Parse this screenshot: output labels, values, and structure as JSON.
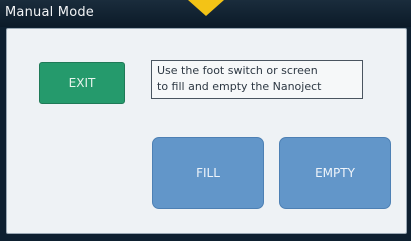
{
  "window": {
    "title": "Manual Mode"
  },
  "indicator": {
    "icon": "down-arrow-indicator-icon",
    "color": "#f3c316"
  },
  "controls": {
    "exit_label": "EXIT",
    "fill_label": "FILL",
    "empty_label": "EMPTY"
  },
  "instructions": {
    "line1": "Use the foot switch or screen",
    "line2": "to fill and empty the Nanoject"
  },
  "colors": {
    "exit_button": "#259a6c",
    "action_button": "#6296c9",
    "title_bar": "#0e2030",
    "panel": "#eef2f5"
  }
}
